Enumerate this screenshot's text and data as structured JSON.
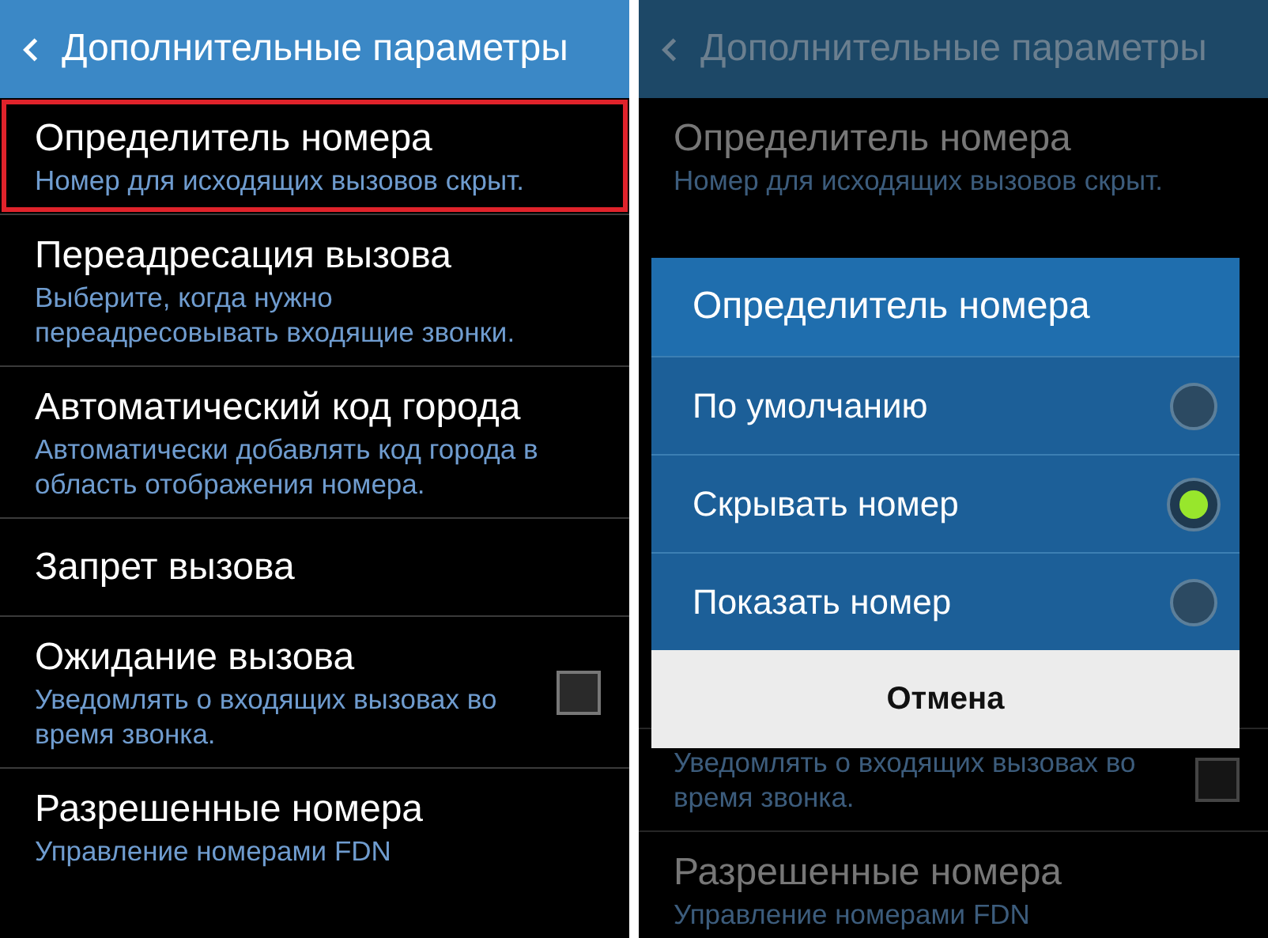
{
  "screens": [
    {
      "dimmed": false,
      "header": {
        "title": "Дополнительные параметры"
      },
      "items_above": [
        {
          "title": "Определитель номера",
          "subtitle": "Номер для исходящих вызовов скрыт.",
          "highlighted": true
        },
        {
          "title": "Переадресация вызова",
          "subtitle": "Выберите, когда нужно переадресовывать входящие звонки.",
          "highlighted": false
        },
        {
          "title": "Автоматический код города",
          "subtitle": "Автоматически добавлять код города в область отображения номера.",
          "highlighted": false
        },
        {
          "title": "Запрет вызова",
          "highlighted": false
        },
        {
          "title": "Ожидание вызова",
          "subtitle": "Уведомлять о входящих вызовах во время звонка.",
          "highlighted": false,
          "checkbox": {
            "checked": false
          }
        },
        {
          "title": "Разрешенные номера",
          "subtitle": "Управление номерами FDN",
          "highlighted": false
        }
      ]
    },
    {
      "dimmed": true,
      "header": {
        "title": "Дополнительные параметры"
      },
      "items_above": [
        {
          "title": "Определитель номера",
          "subtitle": "Номер для исходящих вызовов скрыт.",
          "highlighted": false
        }
      ],
      "dialog": {
        "title": "Определитель номера",
        "options": [
          {
            "label": "По умолчанию",
            "selected": false
          },
          {
            "label": "Скрывать номер",
            "selected": true
          },
          {
            "label": "Показать номер",
            "selected": false
          }
        ],
        "cancel": "Отмена"
      },
      "items_below": [
        {
          "subtitle": "Уведомлять о входящих вызовах во время звонка.",
          "highlighted": false,
          "checkbox": {
            "checked": false
          }
        },
        {
          "title": "Разрешенные номера",
          "subtitle": "Управление номерами FDN",
          "highlighted": false
        }
      ]
    }
  ]
}
